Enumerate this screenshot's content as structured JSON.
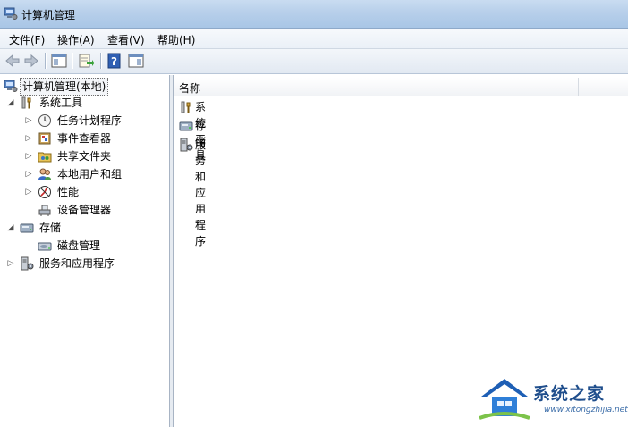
{
  "window": {
    "title": "计算机管理"
  },
  "menu": [
    "文件(F)",
    "操作(A)",
    "查看(V)",
    "帮助(H)"
  ],
  "tree": {
    "root": "计算机管理(本地)",
    "system_tools": "系统工具",
    "task_scheduler": "任务计划程序",
    "event_viewer": "事件查看器",
    "shared_folders": "共享文件夹",
    "local_users": "本地用户和组",
    "performance": "性能",
    "device_manager": "设备管理器",
    "storage": "存储",
    "disk_management": "磁盘管理",
    "services_apps": "服务和应用程序"
  },
  "list": {
    "column_name": "名称",
    "items": [
      "系统工具",
      "存储",
      "服务和应用程序"
    ]
  },
  "watermark": {
    "text": "系统之家",
    "url": "www.xitongzhijia.net"
  }
}
